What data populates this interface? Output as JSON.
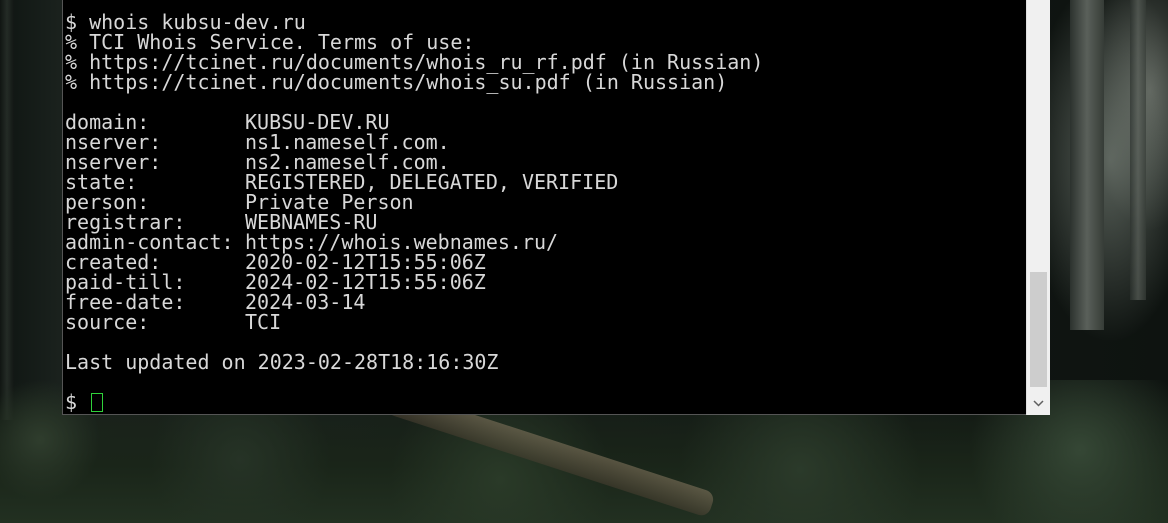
{
  "terminal": {
    "command_line": "$ whois kubsu-dev.ru",
    "header_lines": [
      "% TCI Whois Service. Terms of use:",
      "% https://tcinet.ru/documents/whois_ru_rf.pdf (in Russian)",
      "% https://tcinet.ru/documents/whois_su.pdf (in Russian)"
    ],
    "records": [
      {
        "key": "domain:",
        "value": "KUBSU-DEV.RU"
      },
      {
        "key": "nserver:",
        "value": "ns1.nameself.com."
      },
      {
        "key": "nserver:",
        "value": "ns2.nameself.com."
      },
      {
        "key": "state:",
        "value": "REGISTERED, DELEGATED, VERIFIED"
      },
      {
        "key": "person:",
        "value": "Private Person"
      },
      {
        "key": "registrar:",
        "value": "WEBNAMES-RU"
      },
      {
        "key": "admin-contact:",
        "value": "https://whois.webnames.ru/"
      },
      {
        "key": "created:",
        "value": "2020-02-12T15:55:06Z"
      },
      {
        "key": "paid-till:",
        "value": "2024-02-12T15:55:06Z"
      },
      {
        "key": "free-date:",
        "value": "2024-03-14"
      },
      {
        "key": "source:",
        "value": "TCI"
      }
    ],
    "last_updated": "Last updated on 2023-02-28T18:16:30Z",
    "prompt": "$",
    "colors": {
      "background": "#000000",
      "text": "#d8d8d8",
      "cursor": "#2fd23a"
    }
  },
  "scrollbar": {
    "down_icon": "chevron-down-icon"
  }
}
